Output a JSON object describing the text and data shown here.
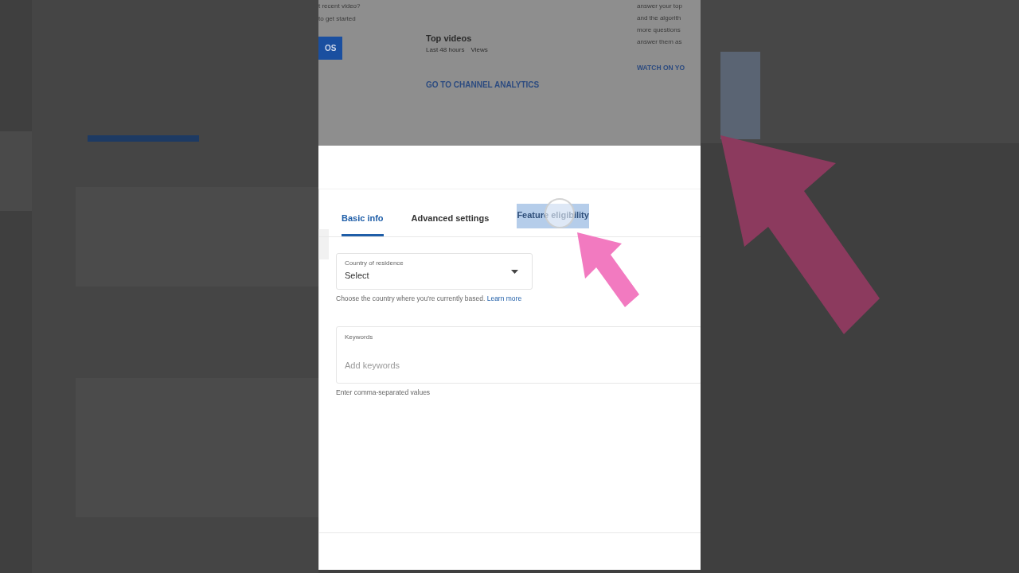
{
  "background_page": {
    "left_column": {
      "lines": [
        "t recent video?",
        "to get started"
      ],
      "button": "OS"
    },
    "middle_column": {
      "title": "Top videos",
      "subtitle": "Last 48 hours",
      "metric": "Views",
      "link": "GO TO CHANNEL ANALYTICS"
    },
    "right_column": {
      "lines": [
        "answer your top",
        "and the algorith",
        "more questions",
        "answer them as"
      ],
      "link": "WATCH ON YO"
    }
  },
  "tabs": [
    {
      "label": "Basic info",
      "selected": true,
      "highlighted": false
    },
    {
      "label": "Advanced settings",
      "selected": false,
      "highlighted": false
    },
    {
      "label": "Feature eligibility",
      "selected": false,
      "highlighted": true
    }
  ],
  "country_field": {
    "label": "Country of residence",
    "value": "Select",
    "help": "Choose the country where you're currently based.",
    "help_link": "Learn more"
  },
  "keywords_field": {
    "label": "Keywords",
    "placeholder": "Add keywords",
    "help": "Enter comma-separated values"
  }
}
